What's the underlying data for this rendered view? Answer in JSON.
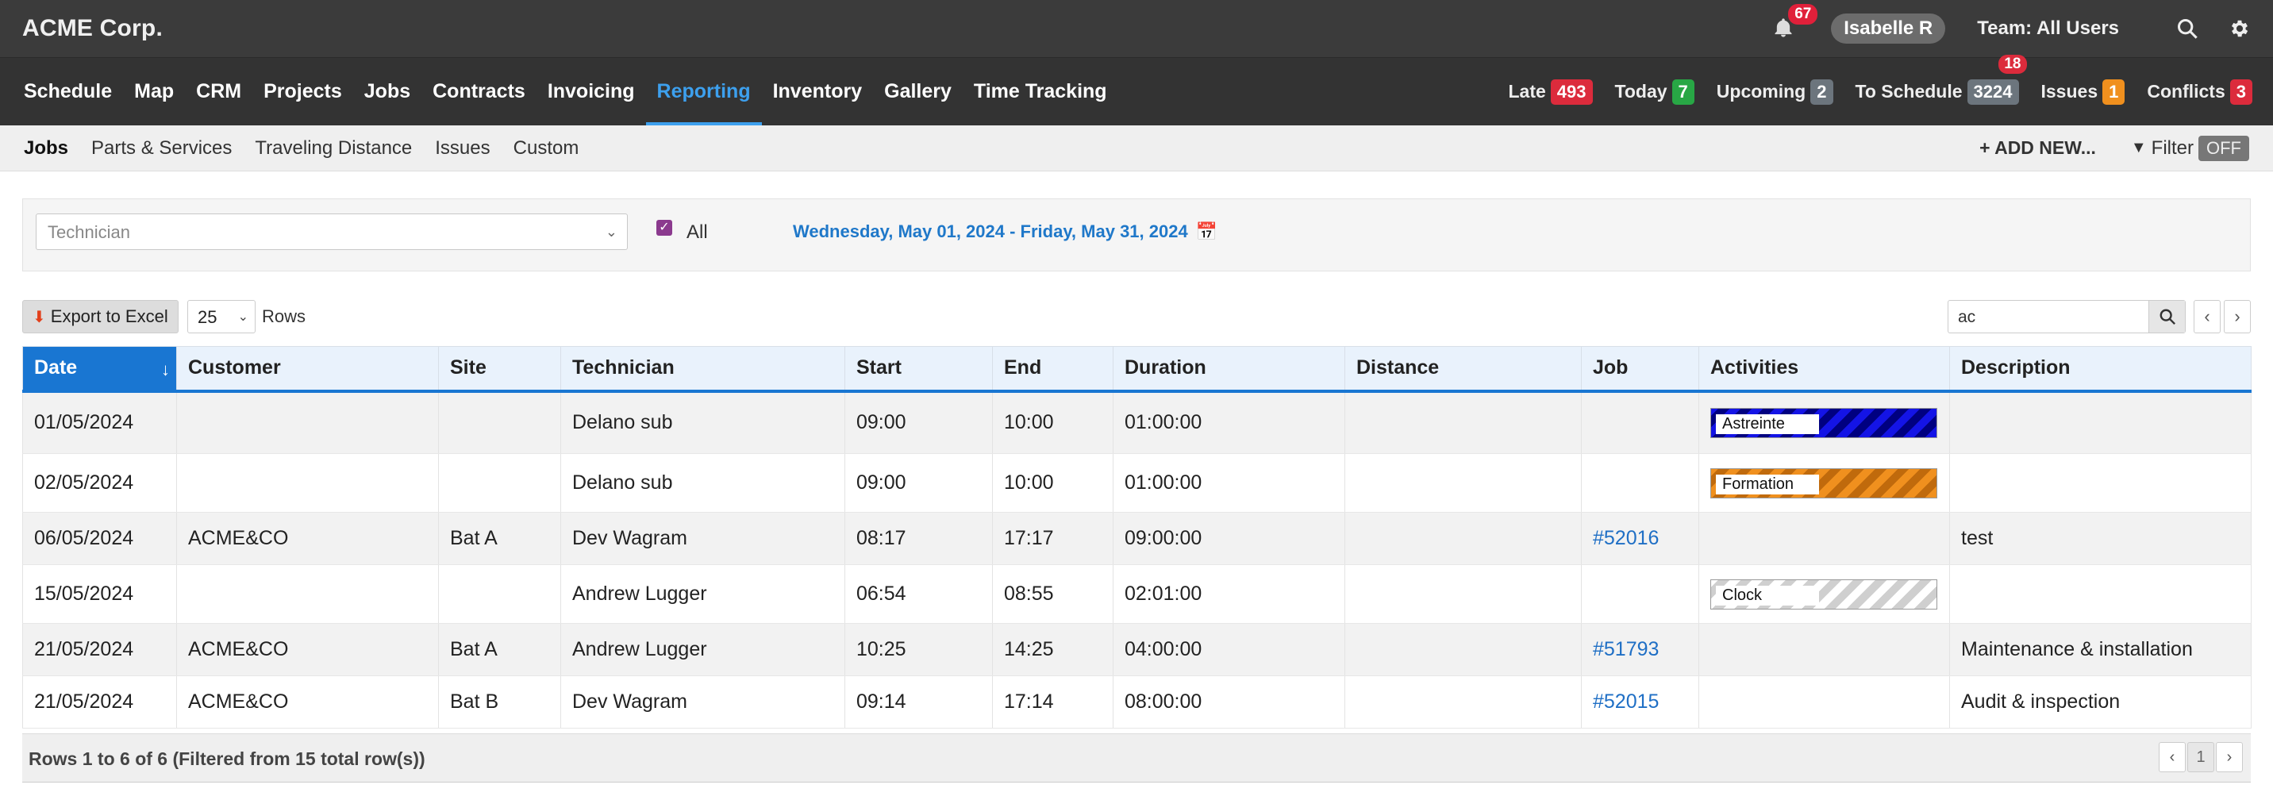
{
  "app": {
    "brand": "ACME Corp.",
    "notification_count": "67",
    "user": "Isabelle R",
    "team": "Team: All Users"
  },
  "nav": {
    "items": [
      "Schedule",
      "Map",
      "CRM",
      "Projects",
      "Jobs",
      "Contracts",
      "Invoicing",
      "Reporting",
      "Inventory",
      "Gallery",
      "Time Tracking"
    ],
    "active": "Reporting",
    "stats": [
      {
        "label": "Late",
        "count": "493",
        "color": "red"
      },
      {
        "label": "Today",
        "count": "7",
        "color": "green"
      },
      {
        "label": "Upcoming",
        "count": "2",
        "color": "gray"
      },
      {
        "label": "To Schedule",
        "count": "3224",
        "color": "gray",
        "badge": "18"
      },
      {
        "label": "Issues",
        "count": "1",
        "color": "orange"
      },
      {
        "label": "Conflicts",
        "count": "3",
        "color": "red"
      }
    ]
  },
  "subnav": {
    "items": [
      "Jobs",
      "Parts & Services",
      "Traveling Distance",
      "Issues",
      "Custom"
    ],
    "active": "Jobs",
    "add_new": "+ ADD NEW...",
    "filter_label": "Filter",
    "filter_state": "OFF"
  },
  "filters": {
    "technician_placeholder": "Technician",
    "all_label": "All",
    "all_checked": true,
    "date_range": "Wednesday, May 01, 2024 - Friday, May 31, 2024"
  },
  "toolbar": {
    "export_label": "Export to Excel",
    "rows_value": "25",
    "rows_label": "Rows",
    "search_value": "ac"
  },
  "table": {
    "columns": [
      "Date",
      "Customer",
      "Site",
      "Technician",
      "Start",
      "End",
      "Duration",
      "Distance",
      "Job",
      "Activities",
      "Description"
    ],
    "sorted_column": "Date",
    "rows": [
      {
        "date": "01/05/2024",
        "customer": "",
        "site": "",
        "technician": "Delano sub",
        "start": "09:00",
        "end": "10:00",
        "duration": "01:00:00",
        "distance": "",
        "job": "",
        "activity": "Astreinte",
        "activity_color": "#1414e6",
        "description": ""
      },
      {
        "date": "02/05/2024",
        "customer": "",
        "site": "",
        "technician": "Delano sub",
        "start": "09:00",
        "end": "10:00",
        "duration": "01:00:00",
        "distance": "",
        "job": "",
        "activity": "Formation",
        "activity_color": "#f0901e",
        "description": ""
      },
      {
        "date": "06/05/2024",
        "customer": "ACME&CO",
        "site": "Bat A",
        "technician": "Dev Wagram",
        "start": "08:17",
        "end": "17:17",
        "duration": "09:00:00",
        "distance": "",
        "job": "#52016",
        "activity": "",
        "activity_color": "",
        "description": "test"
      },
      {
        "date": "15/05/2024",
        "customer": "",
        "site": "",
        "technician": "Andrew Lugger",
        "start": "06:54",
        "end": "08:55",
        "duration": "02:01:00",
        "distance": "",
        "job": "",
        "activity": "Clock",
        "activity_color": "#cfcfcf",
        "description": ""
      },
      {
        "date": "21/05/2024",
        "customer": "ACME&CO",
        "site": "Bat A",
        "technician": "Andrew Lugger",
        "start": "10:25",
        "end": "14:25",
        "duration": "04:00:00",
        "distance": "",
        "job": "#51793",
        "activity": "",
        "activity_color": "",
        "description": "Maintenance & installation"
      },
      {
        "date": "21/05/2024",
        "customer": "ACME&CO",
        "site": "Bat B",
        "technician": "Dev Wagram",
        "start": "09:14",
        "end": "17:14",
        "duration": "08:00:00",
        "distance": "",
        "job": "#52015",
        "activity": "",
        "activity_color": "",
        "description": "Audit & inspection"
      }
    ]
  },
  "footer": {
    "info": "Rows 1 to 6 of 6 (Filtered from 15 total row(s))",
    "page": "1"
  }
}
